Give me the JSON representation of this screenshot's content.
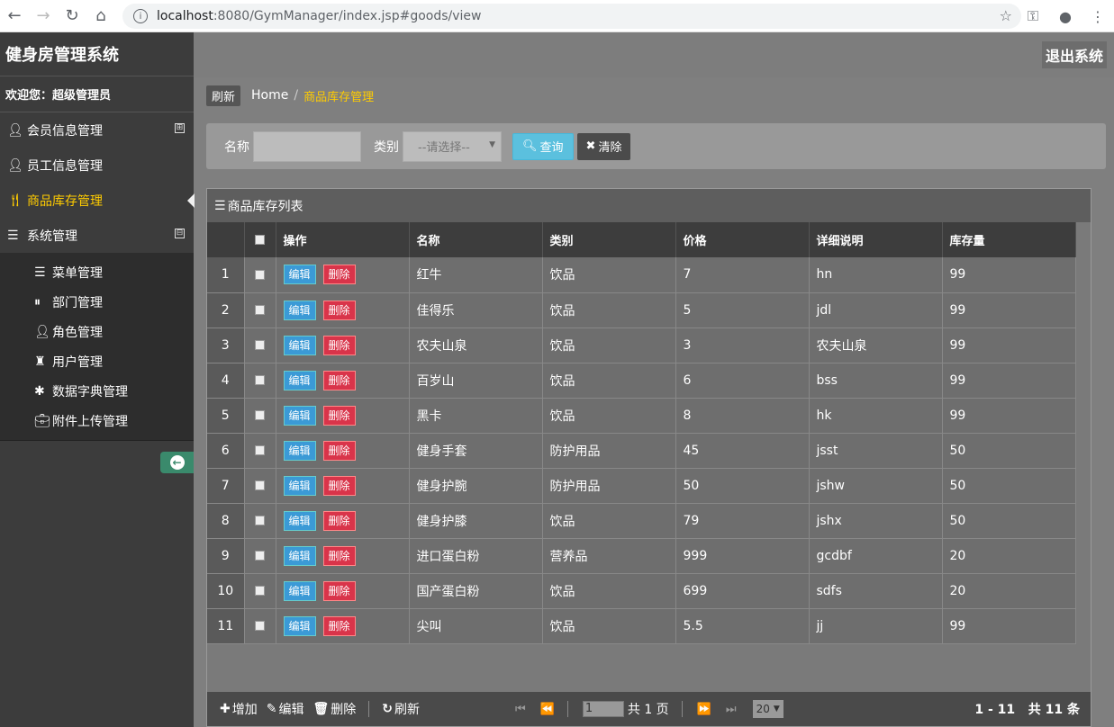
{
  "browser": {
    "url_host": "localhost",
    "url_path": ":8080/GymManager/index.jsp#goods/view"
  },
  "app": {
    "title": "健身房管理系统",
    "welcome": "欢迎您：超级管理员",
    "logout": "退出系统"
  },
  "sidebar": {
    "items": [
      {
        "label": "会员信息管理",
        "icon": "user-icon",
        "toggle": "⊞"
      },
      {
        "label": "员工信息管理",
        "icon": "user-icon"
      },
      {
        "label": "商品库存管理",
        "icon": "utensils-icon"
      },
      {
        "label": "系统管理",
        "icon": "list-icon",
        "toggle": "⊟"
      }
    ],
    "subitems": [
      {
        "label": "菜单管理",
        "icon": "list-icon"
      },
      {
        "label": "部门管理",
        "icon": "columns-icon"
      },
      {
        "label": "角色管理",
        "icon": "user-icon"
      },
      {
        "label": "用户管理",
        "icon": "tower-icon"
      },
      {
        "label": "数据字典管理",
        "icon": "asterisk-icon"
      },
      {
        "label": "附件上传管理",
        "icon": "briefcase-icon"
      }
    ]
  },
  "breadcrumb": {
    "refresh": "刷新",
    "home": "Home",
    "sep": "/",
    "current": "商品库存管理"
  },
  "search": {
    "name_label": "名称",
    "category_label": "类别",
    "category_placeholder": "--请选择--",
    "query_button": "查询",
    "clear_button": "清除"
  },
  "grid": {
    "title": "商品库存列表",
    "columns": [
      "操作",
      "名称",
      "类别",
      "价格",
      "详细说明",
      "库存量"
    ],
    "edit_label": "编辑",
    "delete_label": "删除",
    "rows": [
      {
        "n": "1",
        "name": "红牛",
        "cat": "饮品",
        "price": "7",
        "desc": "hn",
        "stock": "99"
      },
      {
        "n": "2",
        "name": "佳得乐",
        "cat": "饮品",
        "price": "5",
        "desc": "jdl",
        "stock": "99"
      },
      {
        "n": "3",
        "name": "农夫山泉",
        "cat": "饮品",
        "price": "3",
        "desc": "农夫山泉",
        "stock": "99"
      },
      {
        "n": "4",
        "name": "百岁山",
        "cat": "饮品",
        "price": "6",
        "desc": "bss",
        "stock": "99"
      },
      {
        "n": "5",
        "name": "黑卡",
        "cat": "饮品",
        "price": "8",
        "desc": "hk",
        "stock": "99"
      },
      {
        "n": "6",
        "name": "健身手套",
        "cat": "防护用品",
        "price": "45",
        "desc": "jsst",
        "stock": "50"
      },
      {
        "n": "7",
        "name": "健身护腕",
        "cat": "防护用品",
        "price": "50",
        "desc": "jshw",
        "stock": "50"
      },
      {
        "n": "8",
        "name": "健身护膝",
        "cat": "饮品",
        "price": "79",
        "desc": "jshx",
        "stock": "50"
      },
      {
        "n": "9",
        "name": "进口蛋白粉",
        "cat": "营养品",
        "price": "999",
        "desc": "gcdbf",
        "stock": "20"
      },
      {
        "n": "10",
        "name": "国产蛋白粉",
        "cat": "饮品",
        "price": "699",
        "desc": "sdfs",
        "stock": "20"
      },
      {
        "n": "11",
        "name": "尖叫",
        "cat": "饮品",
        "price": "5.5",
        "desc": "jj",
        "stock": "99"
      }
    ]
  },
  "pager": {
    "add": "增加",
    "edit": "编辑",
    "delete": "删除",
    "refresh": "刷新",
    "page_value": "1",
    "total_pages": "共 1 页",
    "page_size": "20",
    "range": "1 - 11",
    "total": "共 11 条"
  }
}
